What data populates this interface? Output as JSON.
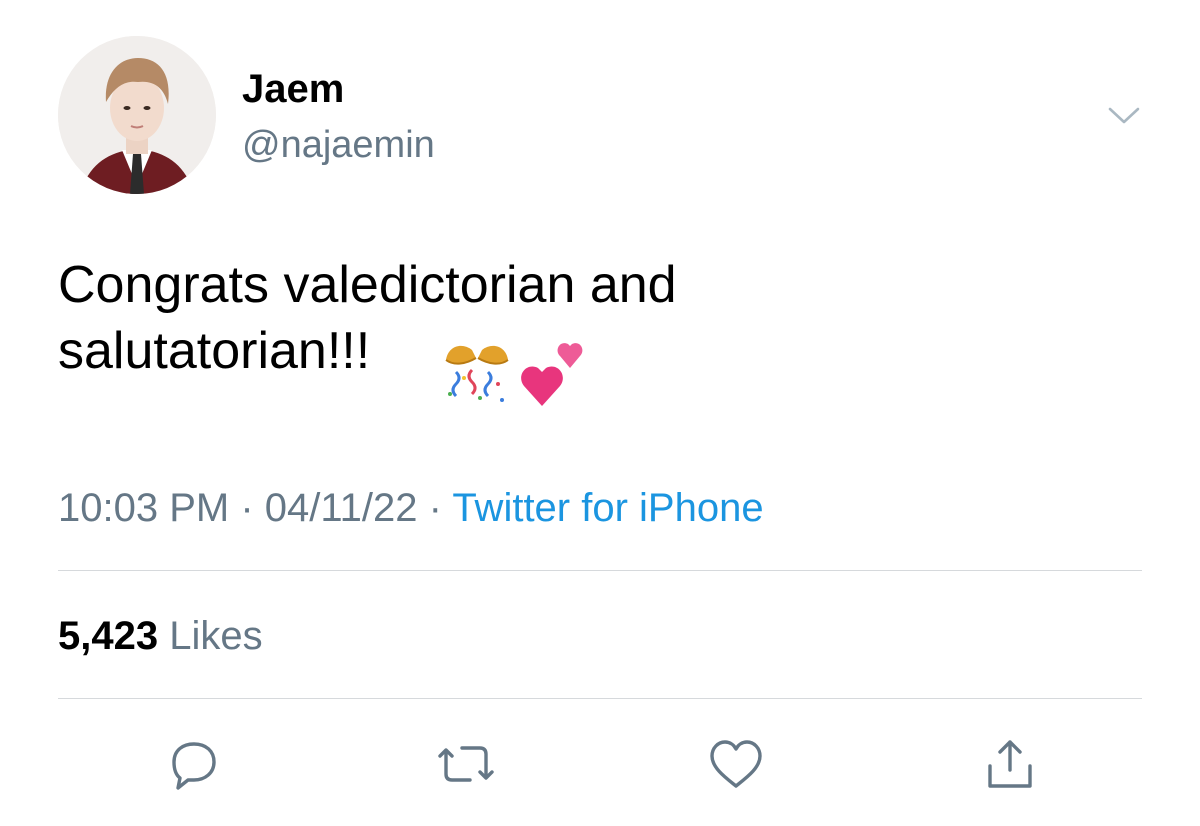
{
  "tweet": {
    "author": {
      "display_name": "Jaem",
      "handle": "@najaemin",
      "avatar_icon": "profile-photo"
    },
    "text_line1": "Congrats valedictorian and",
    "text_line2": "salutatorian!!!",
    "emojis": [
      "party-popper-icon",
      "two-hearts-icon"
    ],
    "time": "10:03 PM",
    "separator": " · ",
    "date": "04/11/22",
    "source": "Twitter for iPhone",
    "likes_count": "5,423",
    "likes_label": "Likes"
  },
  "actions": [
    "reply-icon",
    "retweet-icon",
    "like-icon",
    "share-icon"
  ],
  "colors": {
    "text": "#000000",
    "secondary": "#657786",
    "link": "#1b95e0",
    "divider": "#d6d9dc"
  }
}
